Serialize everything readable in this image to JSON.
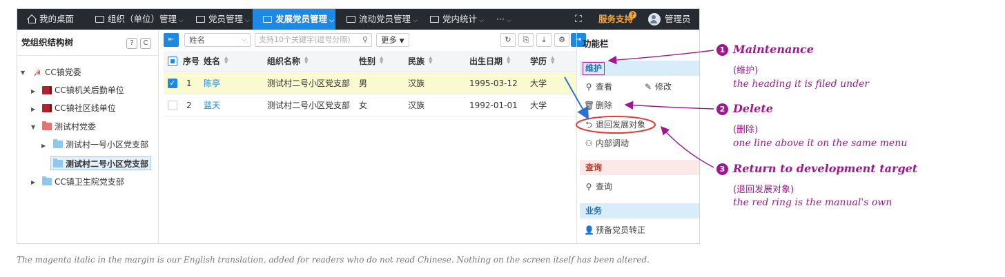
{
  "topnav": {
    "items": [
      {
        "label": "我的桌面"
      },
      {
        "label": "组织（单位）管理"
      },
      {
        "label": "党员管理"
      },
      {
        "label": "发展党员管理"
      },
      {
        "label": "流动党员管理"
      },
      {
        "label": "党内统计"
      },
      {
        "label": "···"
      }
    ],
    "service_label": "服务支持",
    "service_badge": "?",
    "user_label": "管理员"
  },
  "tree": {
    "title": "党组织结构树",
    "help_label": "?",
    "refresh_label": "C",
    "nodes": [
      {
        "label": "CC镇党委"
      },
      {
        "label": "CC镇机关后勤单位"
      },
      {
        "label": "CC镇社区线单位"
      },
      {
        "label": "测试村党委"
      },
      {
        "label": "测试村一号小区党支部"
      },
      {
        "label": "测试村二号小区党支部"
      },
      {
        "label": "CC镇卫生院党支部"
      }
    ]
  },
  "toolbar": {
    "field_select": "姓名",
    "search_placeholder": "支持10个关键字(逗号分隔)",
    "more_label": "更多"
  },
  "grid": {
    "headers": [
      "序号",
      "姓名",
      "组织名称",
      "性别",
      "民族",
      "出生日期",
      "学历"
    ],
    "rows": [
      {
        "no": "1",
        "name": "陈亭",
        "org": "测试村二号小区党支部",
        "gender": "男",
        "ethnicity": "汉族",
        "birth": "1995-03-12",
        "edu": "大学",
        "checked": true
      },
      {
        "no": "2",
        "name": "蓝天",
        "org": "测试村二号小区党支部",
        "gender": "女",
        "ethnicity": "汉族",
        "birth": "1992-01-01",
        "edu": "大学",
        "checked": false
      }
    ]
  },
  "funcpanel": {
    "title": "功能栏",
    "sections": [
      {
        "label": "维护",
        "color": "#d9ecf9",
        "items": [
          "查看",
          "修改",
          "删除",
          "退回发展对象",
          "内部调动"
        ]
      },
      {
        "label": "查询",
        "color": "#fbe9e7",
        "items": [
          "查询"
        ]
      },
      {
        "label": "业务",
        "color": "#d9ecf9",
        "items": [
          "预备党员转正"
        ]
      }
    ]
  },
  "annotations": [
    {
      "num": "1",
      "title": "Maintenance",
      "cn": "(维护)",
      "note": "the heading it is filed under"
    },
    {
      "num": "2",
      "title": "Delete",
      "cn": "(删除)",
      "note": "one line above it on the same menu"
    },
    {
      "num": "3",
      "title": "Return to development target",
      "cn": "(退回发展对象)",
      "note": "the red ring is the manual's own"
    }
  ],
  "caption": "The magenta italic in the margin is our English translation, added for readers who do not read Chinese. Nothing on the screen itself has been altered.",
  "colors": {
    "nav_bg": "#262a31",
    "accent": "#1e88e5",
    "annotation": "#a0188f",
    "ring": "#e53935",
    "selected_row": "#fafad0"
  }
}
